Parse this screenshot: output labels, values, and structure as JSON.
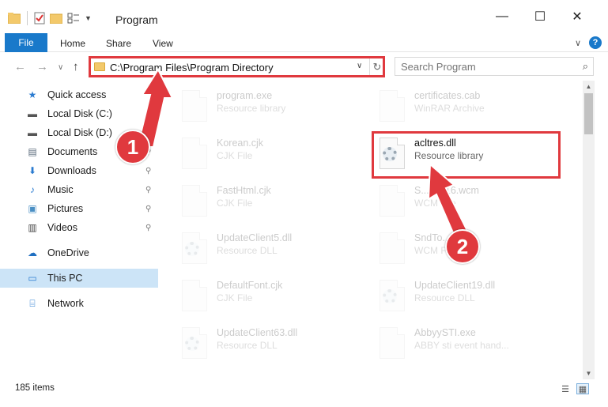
{
  "window": {
    "title": "Program",
    "minimize_glyph": "—",
    "maximize_glyph": "☐",
    "close_glyph": "✕"
  },
  "ribbon": {
    "tabs": [
      "File",
      "Home",
      "Share",
      "View"
    ],
    "help_label": "?",
    "expand_glyph": "∨"
  },
  "navigation": {
    "back_glyph": "←",
    "forward_glyph": "→",
    "recent_glyph": "∨",
    "up_glyph": "↑",
    "address_path": "C:\\Program Files\\Program Directory",
    "address_dropdown_glyph": "∨",
    "refresh_glyph": "↻",
    "search_placeholder": "Search Program",
    "search_glyph": "⌕"
  },
  "sidebar": {
    "items": [
      {
        "label": "Quick access",
        "icon": "star-icon",
        "glyph": "★",
        "color": "#2a7bd0",
        "pinned": false
      },
      {
        "label": "Local Disk (C:)",
        "icon": "drive-icon",
        "glyph": "▬",
        "color": "#555555",
        "pinned": true
      },
      {
        "label": "Local Disk (D:)",
        "icon": "drive-icon",
        "glyph": "▬",
        "color": "#555555",
        "pinned": true
      },
      {
        "label": "Documents",
        "icon": "documents-icon",
        "glyph": "▤",
        "color": "#5b6b7c",
        "pinned": true
      },
      {
        "label": "Downloads",
        "icon": "downloads-icon",
        "glyph": "⬇",
        "color": "#2a7bd0",
        "pinned": true
      },
      {
        "label": "Music",
        "icon": "music-icon",
        "glyph": "♪",
        "color": "#2a7bd0",
        "pinned": true
      },
      {
        "label": "Pictures",
        "icon": "pictures-icon",
        "glyph": "▣",
        "color": "#4a8fc4",
        "pinned": true
      },
      {
        "label": "Videos",
        "icon": "videos-icon",
        "glyph": "▥",
        "color": "#444444",
        "pinned": true
      },
      {
        "label": "OneDrive",
        "icon": "onedrive-icon",
        "glyph": "☁",
        "color": "#1f6fc1",
        "pinned": false
      },
      {
        "label": "This PC",
        "icon": "computer-icon",
        "glyph": "▭",
        "color": "#2a7bd0",
        "pinned": false,
        "selected": true
      },
      {
        "label": "Network",
        "icon": "network-icon",
        "glyph": "⌸",
        "color": "#2a7bd0",
        "pinned": false
      }
    ],
    "pin_glyph": "📌"
  },
  "files": [
    {
      "name": "program.exe",
      "type": "Resource library"
    },
    {
      "name": "certificates.cab",
      "type": "WinRAR Archive"
    },
    {
      "name": "Korean.cjk",
      "type": "CJK File"
    },
    {
      "name": "acltres.dll",
      "type": "Resource library"
    },
    {
      "name": "FastHtml.cjk",
      "type": "CJK File"
    },
    {
      "name": "S...WP16.wcm",
      "type": "WCM File"
    },
    {
      "name": "UpdateClient5.dll",
      "type": "Resource DLL"
    },
    {
      "name": "SndTo....wcm",
      "type": "WCM File"
    },
    {
      "name": "DefaultFont.cjk",
      "type": "CJK File"
    },
    {
      "name": "UpdateClient19.dll",
      "type": "Resource DLL"
    },
    {
      "name": "UpdateClient63.dll",
      "type": "Resource DLL"
    },
    {
      "name": "AbbyySTI.exe",
      "type": "ABBY sti event hand..."
    }
  ],
  "status": {
    "item_count": "185 items"
  },
  "callouts": {
    "step1": "1",
    "step2": "2"
  },
  "colors": {
    "accent": "#1979ca",
    "callout_red": "#e0393e",
    "selection": "#cce4f7"
  }
}
